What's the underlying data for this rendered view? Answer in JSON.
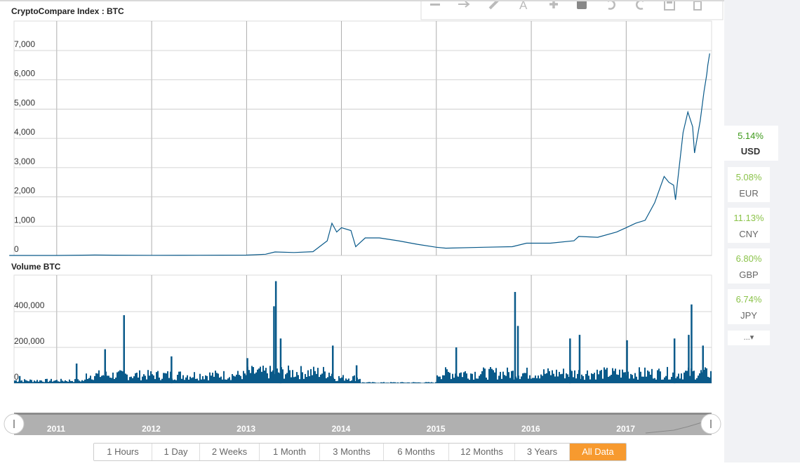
{
  "price_chart": {
    "title": "CryptoCompare Index : BTC",
    "y_ticks": [
      "7,000",
      "6,000",
      "5,000",
      "4,000",
      "3,000",
      "2,000",
      "1,000",
      "0"
    ]
  },
  "volume_chart": {
    "title": "Volume BTC",
    "y_ticks": [
      "400,000",
      "200,000",
      "0"
    ]
  },
  "navigator": {
    "year_labels": [
      "2011",
      "2012",
      "2013",
      "2014",
      "2015",
      "2016",
      "2017"
    ]
  },
  "toolbar": {
    "icons": [
      "minus-icon",
      "arrow-right-icon",
      "pencil-icon",
      "text-icon",
      "plus-icon",
      "square-icon",
      "undo-icon",
      "redo-icon",
      "save-icon",
      "trash-icon"
    ]
  },
  "currencies": [
    {
      "pct": "5.14%",
      "code": "USD",
      "active": true
    },
    {
      "pct": "5.08%",
      "code": "EUR"
    },
    {
      "pct": "11.13%",
      "code": "CNY"
    },
    {
      "pct": "6.80%",
      "code": "GBP"
    },
    {
      "pct": "6.74%",
      "code": "JPY"
    }
  ],
  "more_label": "...▾",
  "ranges": [
    "1 Hours",
    "1 Day",
    "2 Weeks",
    "1 Month",
    "3 Months",
    "6 Months",
    "12 Months",
    "3 Years",
    "All Data"
  ],
  "active_range": "All Data",
  "colors": {
    "line": "#0a5a8a",
    "volume": "#0a5a8a",
    "active_range": "#f79a2f",
    "up": "#8bc34a"
  },
  "chart_data": [
    {
      "type": "line",
      "title": "CryptoCompare Index : BTC",
      "ylim": [
        0,
        7000
      ],
      "x": [
        2010.5,
        2011.0,
        2011.4,
        2011.6,
        2012.0,
        2012.5,
        2013.0,
        2013.2,
        2013.3,
        2013.5,
        2013.7,
        2013.85,
        2013.9,
        2013.95,
        2014.0,
        2014.1,
        2014.15,
        2014.25,
        2014.4,
        2014.6,
        2014.8,
        2015.0,
        2015.1,
        2015.5,
        2015.8,
        2015.95,
        2016.2,
        2016.45,
        2016.5,
        2016.7,
        2016.9,
        2017.0,
        2017.1,
        2017.2,
        2017.3,
        2017.4,
        2017.45,
        2017.5,
        2017.52,
        2017.6,
        2017.65,
        2017.7,
        2017.72,
        2017.78,
        2017.82,
        2017.84,
        2017.85,
        2017.86,
        2017.88
      ],
      "y": [
        0,
        1,
        15,
        10,
        5,
        7,
        13,
        40,
        120,
        100,
        130,
        500,
        1100,
        800,
        950,
        850,
        300,
        600,
        600,
        500,
        380,
        280,
        250,
        280,
        300,
        420,
        420,
        500,
        650,
        620,
        800,
        950,
        1100,
        1200,
        1800,
        2700,
        2500,
        2400,
        1900,
        4200,
        4900,
        4400,
        3500,
        4600,
        5600,
        6000,
        6200,
        6500,
        6900
      ]
    },
    {
      "type": "bar",
      "title": "Volume BTC",
      "ylim": [
        0,
        600000
      ],
      "note": "dense daily volume bars; key peaks estimated",
      "x": [
        2010.6,
        2011.2,
        2011.5,
        2011.7,
        2012.2,
        2013.0,
        2013.28,
        2013.3,
        2013.35,
        2013.9,
        2014.15,
        2015.0,
        2015.2,
        2015.82,
        2015.85,
        2016.4,
        2016.5,
        2017.0,
        2017.5,
        2017.65,
        2017.68,
        2017.8
      ],
      "y": [
        40000,
        110000,
        190000,
        380000,
        150000,
        140000,
        430000,
        570000,
        250000,
        210000,
        100000,
        20000,
        200000,
        510000,
        320000,
        250000,
        270000,
        240000,
        250000,
        270000,
        440000,
        210000
      ]
    }
  ]
}
